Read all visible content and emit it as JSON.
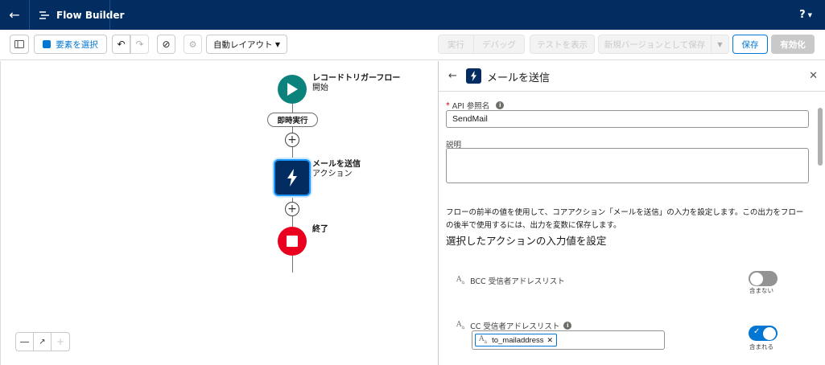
{
  "header": {
    "app_title": "Flow Builder",
    "help_label": "?"
  },
  "toolbar": {
    "select_elements": "要素を選択",
    "layout_select": "自動レイアウト",
    "run": "実行",
    "debug": "デバッグ",
    "show_tests": "テストを表示",
    "save_as_new_version": "新規バージョンとして保存",
    "save": "保存",
    "activate": "有効化"
  },
  "canvas": {
    "start": {
      "title": "レコードトリガーフロー",
      "subtitle": "開始",
      "color": "#0b827c"
    },
    "path_label": "即時実行",
    "action": {
      "title": "メールを送信",
      "subtitle": "アクション",
      "color": "#032d60"
    },
    "end": {
      "title": "終了",
      "color": "#ea001e"
    }
  },
  "panel": {
    "title": "メールを送信",
    "api_name_label": "API 参照名",
    "api_name_value": "SendMail",
    "description_label": "説明",
    "description_value": "",
    "help_text": "フローの前半の値を使用して、コアアクション「メールを送信」の入力を設定します。この出力をフローの後半で使用するには、出力を変数に保存します。",
    "section_title": "選択したアクションの入力値を設定",
    "inputs": [
      {
        "label": "BCC 受信者アドレスリスト",
        "toggle_caption": "含まない",
        "included": false
      },
      {
        "label": "CC 受信者アドレスリスト",
        "toggle_caption": "含まれる",
        "included": true,
        "value": "to_mailaddress"
      }
    ]
  },
  "colors": {
    "brand": "#0176d3",
    "header": "#032d60"
  }
}
